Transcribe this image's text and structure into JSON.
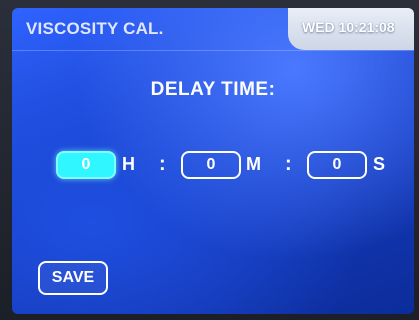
{
  "header": {
    "title": "VISCOSITY CAL.",
    "clock": "WED 10:21:08"
  },
  "delay": {
    "title": "DELAY TIME:",
    "hours": "0",
    "hours_unit": "H",
    "minutes": "0",
    "minutes_unit": "M",
    "seconds": "0",
    "seconds_unit": "S",
    "separator": ":"
  },
  "actions": {
    "save_label": "SAVE"
  },
  "colors": {
    "screen_blue": "#1f4fe0",
    "active_field": "#2ff6ff",
    "text": "#ffffff"
  }
}
